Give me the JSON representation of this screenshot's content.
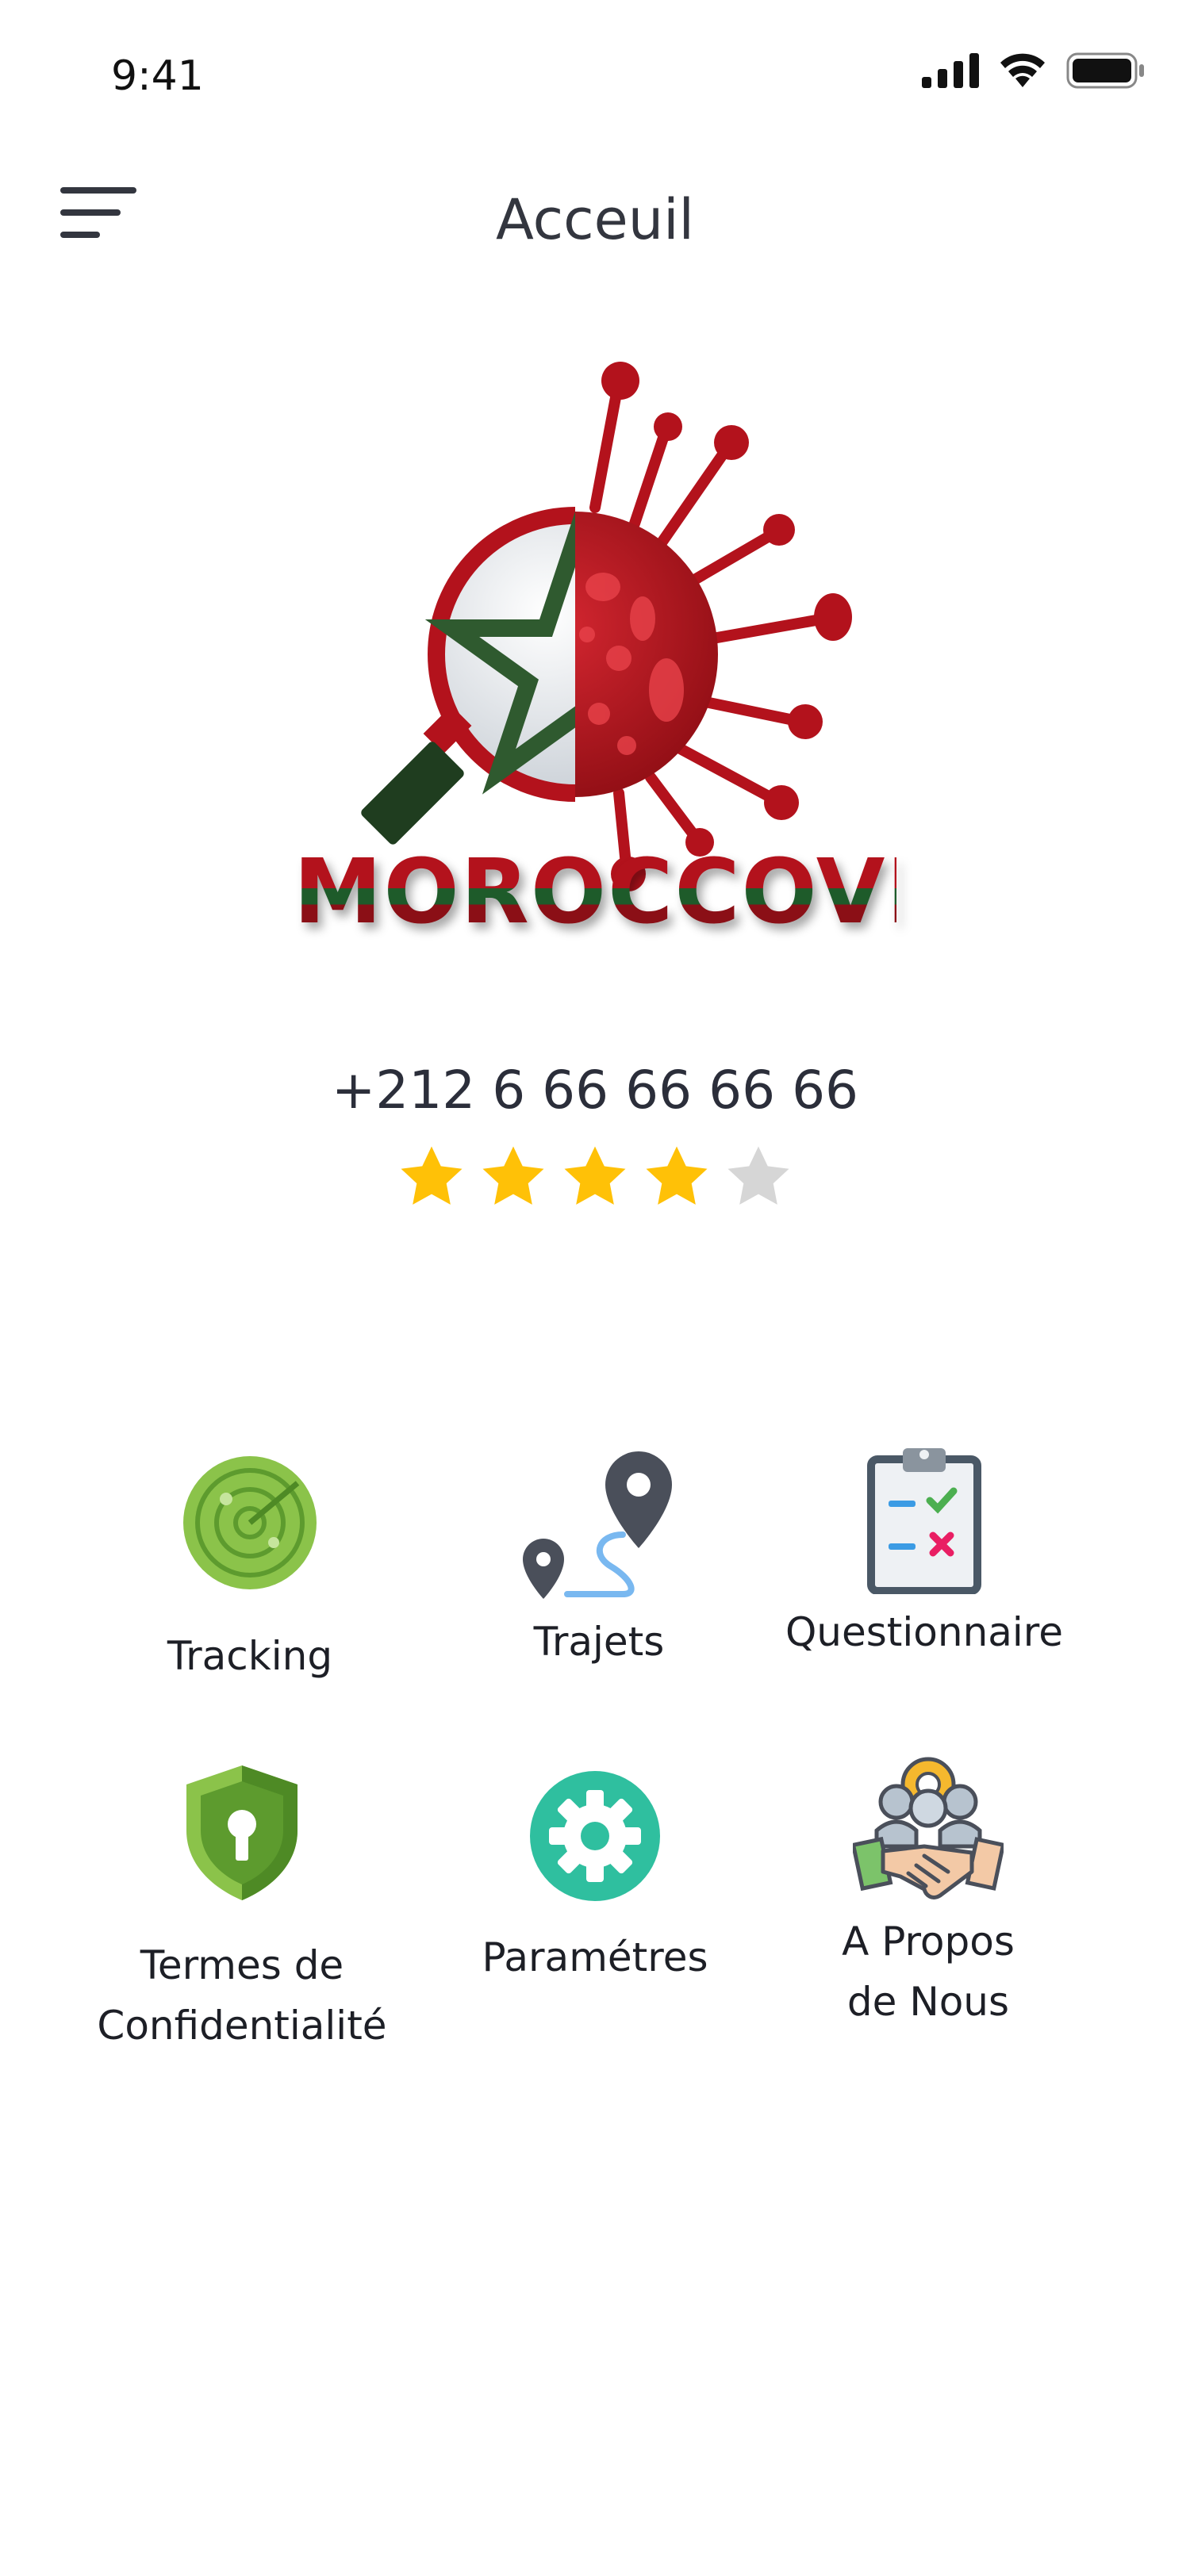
{
  "status_bar": {
    "time": "9:41"
  },
  "header": {
    "title": "Acceuil",
    "menu_icon": "hamburger-menu-icon"
  },
  "logo": {
    "text": "MOROCCOVID"
  },
  "profile": {
    "phone": "+212 6 66 66 66 66",
    "rating": 4,
    "rating_max": 5
  },
  "colors": {
    "star_on": "#FFC107",
    "star_off": "#D6D6D6",
    "virus_red": "#B3121C",
    "flag_green": "#2F5A2F"
  },
  "menu": {
    "tracking": {
      "label": "Tracking",
      "icon": "radar-icon"
    },
    "trajets": {
      "label": "Trajets",
      "icon": "route-pin-icon"
    },
    "questionnaire": {
      "label": "Questionnaire",
      "icon": "clipboard-checklist-icon"
    },
    "privacy": {
      "label": "Termes de\nConfidentialité",
      "icon": "shield-lock-icon"
    },
    "settings": {
      "label": "Paramétres",
      "icon": "gear-icon"
    },
    "about": {
      "label": "A Propos\nde Nous",
      "icon": "handshake-team-icon"
    }
  }
}
